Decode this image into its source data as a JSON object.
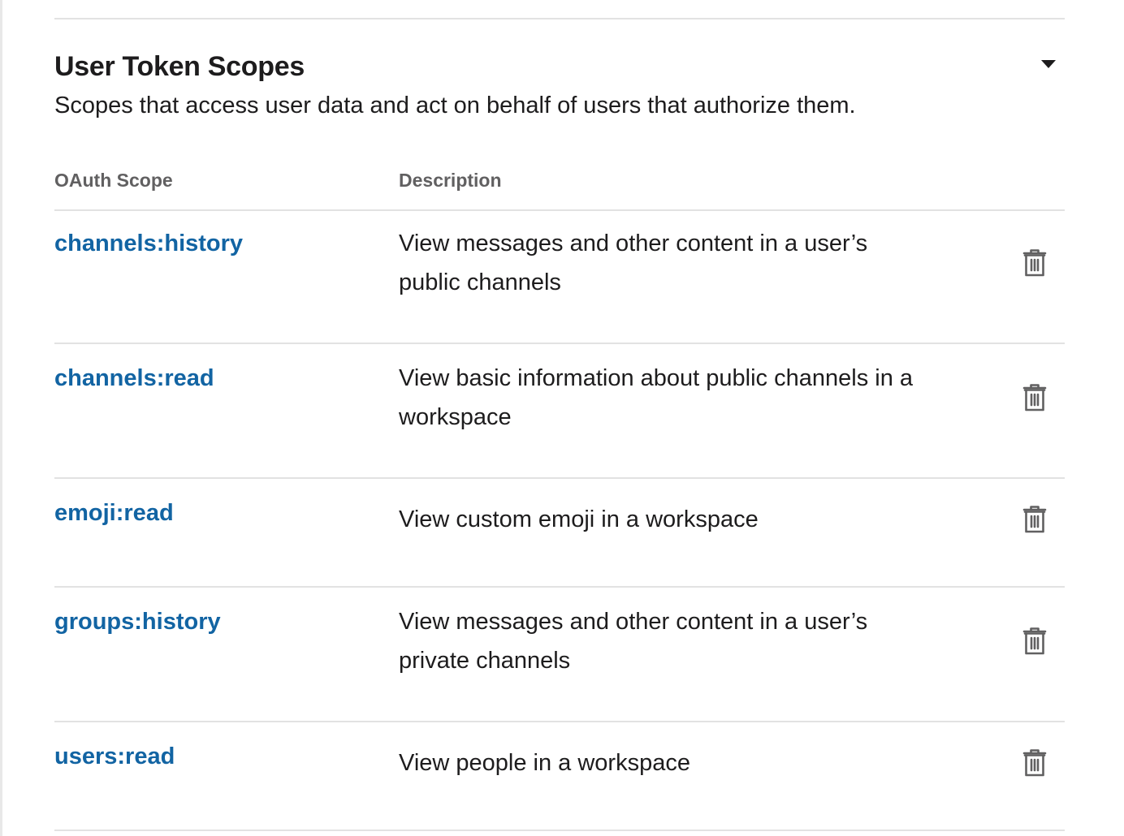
{
  "section": {
    "title": "User Token Scopes",
    "description": "Scopes that access user data and act on behalf of users that authorize them."
  },
  "table": {
    "headers": {
      "scope": "OAuth Scope",
      "description": "Description"
    },
    "rows": [
      {
        "scope": "channels:history",
        "description": "View messages and other content in a user’s public channels"
      },
      {
        "scope": "channels:read",
        "description": "View basic information about public channels in a workspace"
      },
      {
        "scope": "emoji:read",
        "description": "View custom emoji in a workspace"
      },
      {
        "scope": "groups:history",
        "description": "View messages and other content in a user’s private channels"
      },
      {
        "scope": "users:read",
        "description": "View people in a workspace"
      }
    ]
  },
  "icons": {
    "toggle": "caret-down-icon",
    "remove": "trash-icon"
  },
  "colors": {
    "link": "#1264a3",
    "text": "#1d1c1d",
    "muted": "#616061",
    "divider": "#e2e2e2"
  }
}
